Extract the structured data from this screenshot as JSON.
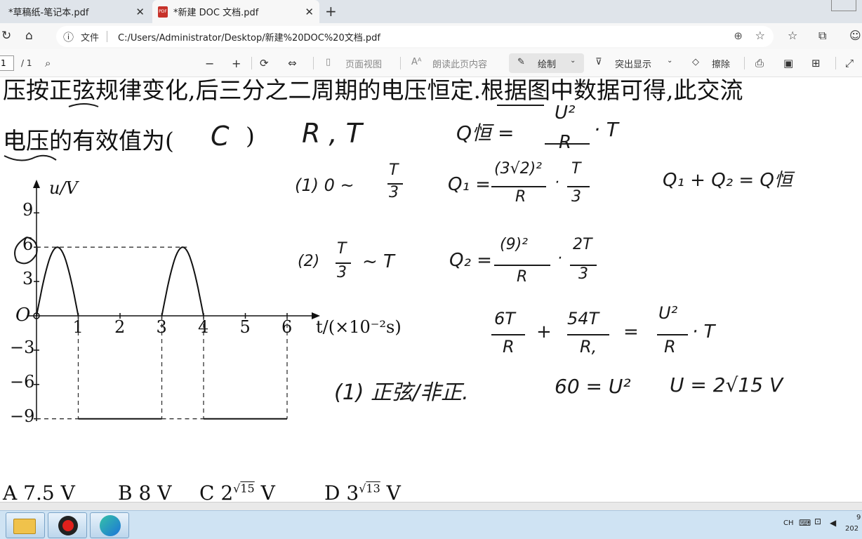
{
  "browser": {
    "tabs": [
      {
        "title": "*草稿纸-笔记本.pdf",
        "active": false
      },
      {
        "title": "*新建 DOC 文档.pdf",
        "active": true
      }
    ],
    "address": {
      "file_label": "文件",
      "url": "C:/Users/Administrator/Desktop/新建%20DOC%20文档.pdf"
    }
  },
  "pdf_toolbar": {
    "page_current": "1",
    "page_total": "/ 1",
    "page_view": "页面视图",
    "read_aloud": "朗读此页内容",
    "draw": "绘制",
    "highlight": "突出显示",
    "erase": "擦除"
  },
  "document": {
    "line1": "压按正弦规律变化,后三分之二周期的电压恒定.根据图中数据可得,此交流",
    "line2": "电压的有效值为(",
    "line2_close": ")",
    "answer_mark": "C",
    "graph": {
      "y_label": "u/V",
      "x_label": "t/(×10⁻²s)",
      "origin": "O",
      "y_ticks": [
        "9",
        "6",
        "3",
        "−3",
        "−6",
        "−9"
      ],
      "x_ticks": [
        "1",
        "2",
        "3",
        "4",
        "5",
        "6"
      ]
    },
    "options": [
      {
        "letter": "A",
        "text": "7.5 V"
      },
      {
        "letter": "B",
        "text": "8 V"
      },
      {
        "letter": "C",
        "text": "2√15 V",
        "coef": "2",
        "radicand": "15"
      },
      {
        "letter": "D",
        "text": "3√13 V",
        "coef": "3",
        "radicand": "13"
      }
    ]
  },
  "handwriting": {
    "vars": "R ,    T",
    "q_const": "Q恒 =",
    "q_const_frac": [
      "U²",
      "R"
    ],
    "q_const_tail": "· T",
    "step1": "(1)   0 ~",
    "step1_frac": [
      "T",
      "3"
    ],
    "q1": "Q₁ =",
    "q1_frac": [
      "(3√2)²",
      "R"
    ],
    "q1_frac2": [
      "T",
      "3"
    ],
    "sum": "Q₁ + Q₂ = Q恒",
    "step2": "(2)",
    "step2_frac": [
      "T",
      "3"
    ],
    "step2_tail": "~ T",
    "q2": "Q₂ =",
    "q2_frac": [
      "(9)²",
      "R"
    ],
    "q2_frac2": [
      "2T",
      "3"
    ],
    "eq_left1": [
      "6T",
      "R"
    ],
    "eq_plus": "+",
    "eq_left2": [
      "54T",
      "R,"
    ],
    "eq_equals": "=",
    "eq_right": [
      "U²",
      "R"
    ],
    "eq_right_tail": "· T",
    "note": "(1) 正弦/非正.",
    "sixty": "60 = U²",
    "result": "U = 2√15 V"
  },
  "taskbar": {
    "lang": "CH",
    "clock_a": "9",
    "clock_b": "202"
  },
  "colors": {
    "tab_bar": "#dfe4ea",
    "taskbar": "#cfe3f3",
    "ink": "#1a1a1a",
    "pdf_red": "#c7322a"
  }
}
